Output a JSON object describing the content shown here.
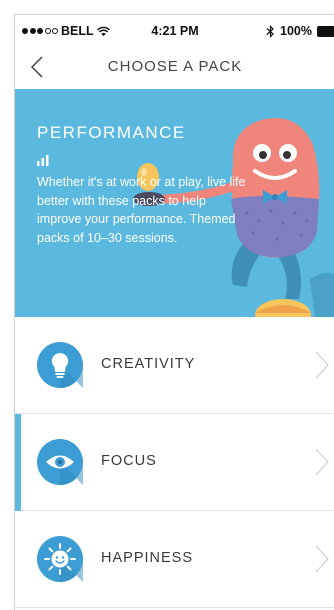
{
  "status_bar": {
    "carrier": "BELL",
    "time": "4:21 PM",
    "battery": "100%"
  },
  "nav": {
    "title": "CHOOSE A PACK"
  },
  "hero": {
    "title": "PERFORMANCE",
    "description": "Whether it's at work or at play, live life better with these packs to help improve your performance. Themed packs of 10–30 sessions.",
    "background": "#5bb9df"
  },
  "packs": [
    {
      "label": "CREATIVITY",
      "icon": "lightbulb-icon",
      "active": false
    },
    {
      "label": "FOCUS",
      "icon": "eye-icon",
      "active": true
    },
    {
      "label": "HAPPINESS",
      "icon": "sun-icon",
      "active": false
    }
  ],
  "colors": {
    "accent": "#5bb9df",
    "icon_blue": "#3b9dd3",
    "character_pink": "#f0857b"
  }
}
